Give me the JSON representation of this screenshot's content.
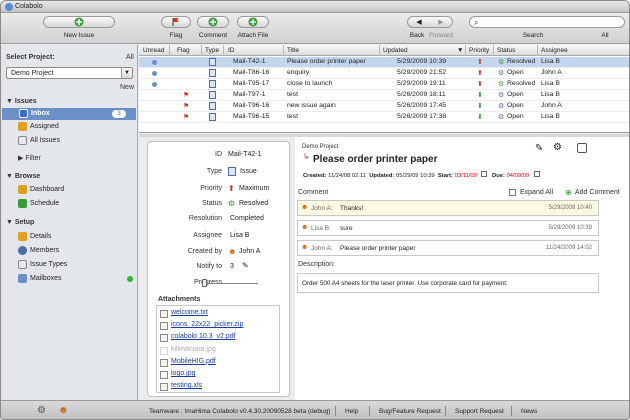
{
  "window": {
    "title": "Colabolo"
  },
  "toolbar": {
    "new_issue": "New Issue",
    "flag": "Flag",
    "comment": "Comment",
    "attach_file": "Attach File",
    "back": "Back",
    "forward": "Forward",
    "search_label": "Search",
    "search_scope": "All",
    "search_value": ""
  },
  "sidebar": {
    "select_project_label": "Select Project:",
    "all_link": "All",
    "project": "Demo Project",
    "new_link": "New",
    "issues_header": "Issues",
    "inbox": "Inbox",
    "inbox_count": "3",
    "assigned": "Assigned",
    "all_issues": "All Issues",
    "filter": "Filter",
    "browse_header": "Browse",
    "dashboard": "Dashboard",
    "schedule": "Schedule",
    "setup_header": "Setup",
    "details": "Details",
    "members": "Members",
    "issue_types": "Issue Types",
    "mailboxes": "Mailboxes"
  },
  "table": {
    "headers": [
      "Unread",
      "Flag",
      "Type",
      "ID",
      "Title",
      "Updated",
      "Priority",
      "Status",
      "Assignee"
    ],
    "rows": [
      {
        "unread": true,
        "flag": false,
        "id": "Mail-T42-1",
        "title": "Please order printer paper",
        "updated": "5/29/2009 10:39",
        "priority": "up",
        "status": "Resolved",
        "assignee": "Lisa B",
        "selected": true
      },
      {
        "unread": true,
        "flag": false,
        "id": "Mail-T86-16",
        "title": "enquiry",
        "updated": "5/29/2009 21:52",
        "priority": "up",
        "status": "Open",
        "assignee": "John A",
        "selected": false
      },
      {
        "unread": true,
        "flag": false,
        "id": "Mail-T95-17",
        "title": "close to launch",
        "updated": "5/29/2009 19:11",
        "priority": "up",
        "status": "Resolved",
        "assignee": "Lisa B",
        "selected": false
      },
      {
        "unread": false,
        "flag": true,
        "id": "Mail-T97-1",
        "title": "test",
        "updated": "5/26/2009 18:11",
        "priority": "down",
        "status": "Open",
        "assignee": "Lisa B",
        "selected": false
      },
      {
        "unread": false,
        "flag": true,
        "id": "Mail-T96-16",
        "title": "new issue again",
        "updated": "5/26/2009 17:45",
        "priority": "down",
        "status": "Open",
        "assignee": "John A",
        "selected": false
      },
      {
        "unread": false,
        "flag": true,
        "id": "Mail-T96-15",
        "title": "test",
        "updated": "5/26/2009 17:38",
        "priority": "down",
        "status": "Open",
        "assignee": "Lisa B",
        "selected": false
      }
    ]
  },
  "detail": {
    "props": {
      "id_label": "ID",
      "id_value": "Mail-T42-1",
      "type_label": "Type",
      "type_value": "Issue",
      "priority_label": "Priority",
      "priority_value": "Maximum",
      "status_label": "Status",
      "status_value": "Resolved",
      "resolution_label": "Resolution",
      "resolution_value": "Completed",
      "assignee_label": "Assignee",
      "assignee_value": "Lisa B",
      "created_by_label": "Created by",
      "created_by_value": "John A",
      "notify_label": "Notify to",
      "notify_value": "3",
      "progress_label": "Progress",
      "progress_value": 0.0
    },
    "attachments_label": "Attachments",
    "attachments": [
      "welcome.txt",
      "icons_22x22_picker.zip",
      "colabolo 10.3_v2.pdf",
      "kilimanjaro.jpg",
      "MobileHIG.pdf",
      "logo.jpg",
      "testing.xls"
    ],
    "project": "Demo Project",
    "title": "Please order printer paper",
    "created_label": "Created:",
    "created": "11/24/08 02:11",
    "updated_label": "Updated:",
    "updated": "05/29/09 10:39",
    "start_label": "Start:",
    "start": "03/11/09",
    "due_label": "Due:",
    "due": "04/09/09",
    "comment_label": "Comment",
    "expand_all": "Expand All",
    "add_comment": "Add Comment",
    "comments": [
      {
        "author": "John A:",
        "text": "Thanks!",
        "date": "5/29/2009 10:40"
      },
      {
        "author": "Lisa B:",
        "text": "sure",
        "date": "5/29/2009 10:39"
      },
      {
        "author": "John A:",
        "text": "Please order printer paper",
        "date": "11/24/2009 14:02"
      }
    ],
    "description_label": "Description:",
    "description": "Order 500 A4 sheets for the laser printer. Use corporate card for payment."
  },
  "status": {
    "version": "Teamware : ImaHima Colabolo v0.4.30.20090528 beta (debug)",
    "help": "Help",
    "bug": "Bug/Feature Request",
    "support": "Support Request",
    "news": "News"
  },
  "colors": {
    "accent": "#6b8fc7",
    "due_red": "#d40000"
  }
}
